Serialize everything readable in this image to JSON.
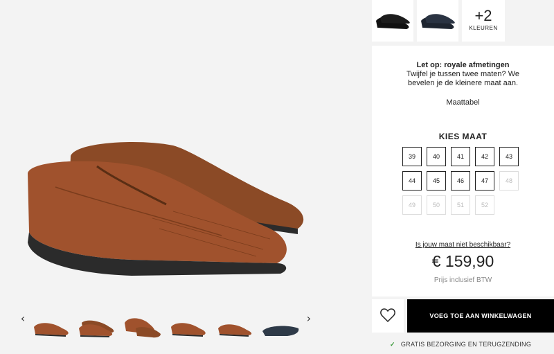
{
  "gallery": {
    "prev_icon": "chevron-left-icon",
    "next_icon": "chevron-right-icon",
    "thumbnails": [
      "view-side",
      "view-pair",
      "view-top",
      "view-side-2",
      "view-side-3",
      "view-sole"
    ]
  },
  "colors": {
    "swatches": [
      "black-shoe",
      "navy-shoe"
    ],
    "more_count": "+2",
    "more_label": "KLEUREN"
  },
  "notice": {
    "title": "Let op: royale afmetingen",
    "body": "Twijfel je tussen twee maten? We bevelen je de kleinere maat aan."
  },
  "size_chart_link": "Maattabel",
  "size_heading": "KIES MAAT",
  "sizes": [
    {
      "label": "39",
      "available": true
    },
    {
      "label": "40",
      "available": true
    },
    {
      "label": "41",
      "available": true
    },
    {
      "label": "42",
      "available": true
    },
    {
      "label": "43",
      "available": true
    },
    {
      "label": "44",
      "available": true
    },
    {
      "label": "45",
      "available": true
    },
    {
      "label": "46",
      "available": true
    },
    {
      "label": "47",
      "available": true
    },
    {
      "label": "48",
      "available": false
    },
    {
      "label": "49",
      "available": false
    },
    {
      "label": "50",
      "available": false
    },
    {
      "label": "51",
      "available": false
    },
    {
      "label": "52",
      "available": false
    }
  ],
  "size_unavailable_link": "Is jouw maat niet beschikbaar?",
  "price": "€ 159,90",
  "price_note": "Prijs inclusief BTW",
  "wishlist_icon": "heart-icon",
  "add_to_cart": "VOEG TOE AAN WINKELWAGEN",
  "shipping": "GRATIS BEZORGING EN TERUGZENDING",
  "shipping_icon": "check-icon",
  "colors_palette": {
    "leather": "#a0522d",
    "sole": "#2b2b2b",
    "cart_bg": "#000000",
    "check": "#3a9a3a"
  }
}
